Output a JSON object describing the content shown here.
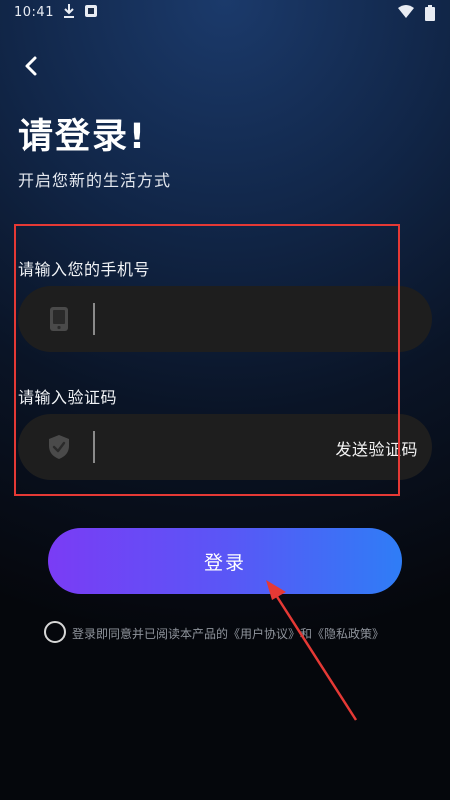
{
  "status_bar": {
    "time": "10:41"
  },
  "header": {
    "title": "请登录!",
    "subtitle": "开启您新的生活方式"
  },
  "phone_field": {
    "label": "请输入您的手机号",
    "value": "",
    "placeholder": ""
  },
  "code_field": {
    "label": "请输入验证码",
    "value": "",
    "placeholder": "",
    "send_label": "发送验证码"
  },
  "login_button": {
    "label": "登录"
  },
  "agreement": {
    "prefix": "登录即同意并已阅读本产品的",
    "user_agreement": "《用户协议》",
    "conjunction": "和",
    "privacy_policy": "《隐私政策》"
  },
  "colors": {
    "annotation_red": "#e53935",
    "button_gradient_start": "#7a3cf5",
    "button_gradient_end": "#2f7df6"
  },
  "icons": {
    "back": "chevron-left-icon",
    "phone": "phone-icon",
    "code": "shield-check-icon"
  }
}
